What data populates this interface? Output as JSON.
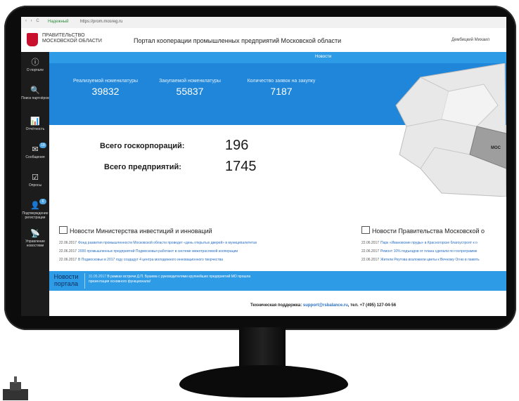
{
  "browser": {
    "nav_icons": "‹ ›  C",
    "secure_label": "Надежный",
    "url": "https://prom.mosreg.ru"
  },
  "header": {
    "gov_line1": "ПРАВИТЕЛЬСТВО",
    "gov_line2": "МОСКОВСКОЙ ОБЛАСТИ",
    "portal_title": "Портал кооперации промышленных предприятий Московской области",
    "user_name": "Дембицкий Михаил"
  },
  "sidebar": {
    "items": [
      {
        "icon": "info-icon",
        "glyph": "ⓘ",
        "label": "О портале"
      },
      {
        "icon": "search-icon",
        "glyph": "🔍",
        "label": "Поиск партнёров"
      },
      {
        "icon": "bar-chart-icon",
        "glyph": "📊",
        "label": "Отчётность"
      },
      {
        "icon": "envelope-icon",
        "glyph": "✉",
        "label": "Сообщения",
        "badge": "18"
      },
      {
        "icon": "checkbox-icon",
        "glyph": "☑",
        "label": "Опросы"
      },
      {
        "icon": "user-icon",
        "glyph": "👤",
        "label": "Подтверждение регистрации",
        "badge": "6"
      },
      {
        "icon": "rss-icon",
        "glyph": "📡",
        "label": "Управление новостями"
      }
    ]
  },
  "news_strip": "Новости",
  "stats": [
    {
      "title": "Реализуемой номенклатуры",
      "value": "39832"
    },
    {
      "title": "Закупаемой номенклатуры",
      "value": "55837"
    },
    {
      "title": "Количество заявок на закупку",
      "value": "7187"
    }
  ],
  "map": {
    "label": "МОС"
  },
  "totals": {
    "corporations_label": "Всего госкорпораций:",
    "corporations_value": "196",
    "enterprises_label": "Всего предприятий:",
    "enterprises_value": "1745"
  },
  "news_left": {
    "title": "Новости Министерства инвестиций и инноваций",
    "items": [
      {
        "date": "22.06.2017",
        "text": "Фонд развития промышленности Московской области проведет «день открытых дверей» в муниципалитетах"
      },
      {
        "date": "22.06.2017",
        "text": "2000 промышленных предприятий Подмосковья работают в системе межотраслевой кооперации"
      },
      {
        "date": "22.06.2017",
        "text": "В Подмосковье в 2017 году создадут 4 центра молодежного инновационного творчества"
      }
    ]
  },
  "news_right": {
    "title": "Новости Правительства Московской о",
    "items": [
      {
        "date": "22.06.2017",
        "text": "Парк «Ивановские пруды» в Красногорске благоустроят к о"
      },
      {
        "date": "22.06.2017",
        "text": "Ремонт 10% подъездов от плана сделали по госпрограмме"
      },
      {
        "date": "22.06.2017",
        "text": "Жители Реутова возложили цветы к Вечному Огню в память"
      }
    ]
  },
  "portal_news": {
    "label_line1": "Новости",
    "label_line2": "портала",
    "date": "31.05.2017",
    "text": "В рамках встречи Д.П. Бушева с руководителями крупнейших предприятий МО прошла презентация основного функционала!"
  },
  "footer": {
    "label": "Техническая поддержка:",
    "email": "support@rsbalance.ru",
    "phone": ", тел. +7 (495) 127-04-56"
  },
  "colors": {
    "accent_blue": "#1f86da",
    "strip_blue": "#2e9be6",
    "sidebar_dark": "#1c1c1c",
    "coat_red": "#c8102e"
  }
}
